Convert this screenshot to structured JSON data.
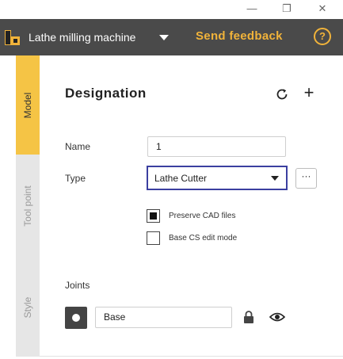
{
  "window_controls": {
    "minimize": "—",
    "maximize": "❐",
    "close": "✕"
  },
  "header": {
    "machine_name": "Lathe milling machine",
    "send_feedback": "Send feedback",
    "help": "?",
    "accent_color": "#f1b33a"
  },
  "tabs": [
    {
      "label": "Model",
      "active": true
    },
    {
      "label": "Tool point",
      "active": false
    },
    {
      "label": "Style",
      "active": false
    }
  ],
  "panel": {
    "title": "Designation",
    "add": "+",
    "name_label": "Name",
    "name_value": "1",
    "type_label": "Type",
    "type_value": "Lathe Cutter",
    "more": "···",
    "preserve_cad": {
      "label": "Preserve CAD files",
      "checked": true
    },
    "base_cs_edit": {
      "label": "Base CS edit mode",
      "checked": false
    },
    "joints_label": "Joints",
    "joint_value": "Base"
  },
  "icons": [
    "window-minimize-icon",
    "window-maximize-icon",
    "window-close-icon",
    "chevron-down-icon",
    "help-icon",
    "refresh-icon",
    "add-icon",
    "lock-icon",
    "eye-icon"
  ]
}
